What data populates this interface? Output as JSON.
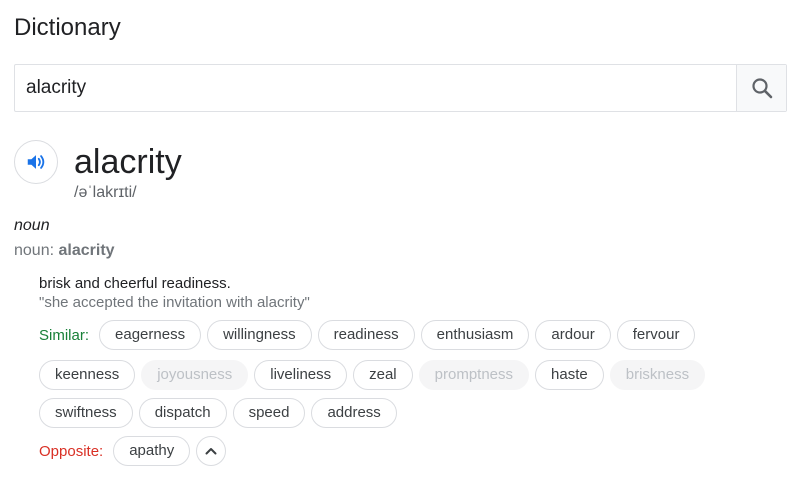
{
  "title": "Dictionary",
  "search": {
    "value": "alacrity",
    "icon": "search-icon"
  },
  "entry": {
    "speaker_icon": "speaker-icon",
    "word": "alacrity",
    "phonetic": "/əˈlakrɪti/",
    "part_of_speech": "noun",
    "noun_label": "noun:",
    "noun_word": "alacrity",
    "definition": "brisk and cheerful readiness.",
    "example": "\"she accepted the invitation with alacrity\""
  },
  "similar": {
    "label": "Similar:",
    "rows": [
      [
        {
          "text": "eagerness",
          "faded": false
        },
        {
          "text": "willingness",
          "faded": false
        },
        {
          "text": "readiness",
          "faded": false
        },
        {
          "text": "enthusiasm",
          "faded": false
        },
        {
          "text": "ardour",
          "faded": false
        },
        {
          "text": "fervour",
          "faded": false
        }
      ],
      [
        {
          "text": "keenness",
          "faded": false
        },
        {
          "text": "joyousness",
          "faded": true
        },
        {
          "text": "liveliness",
          "faded": false
        },
        {
          "text": "zeal",
          "faded": false
        },
        {
          "text": "promptness",
          "faded": true
        },
        {
          "text": "haste",
          "faded": false
        },
        {
          "text": "briskness",
          "faded": true
        }
      ],
      [
        {
          "text": "swiftness",
          "faded": false
        },
        {
          "text": "dispatch",
          "faded": false
        },
        {
          "text": "speed",
          "faded": false
        },
        {
          "text": "address",
          "faded": false
        }
      ]
    ]
  },
  "opposite": {
    "label": "Opposite:",
    "items": [
      {
        "text": "apathy",
        "faded": false
      }
    ],
    "collapse_icon": "chevron-up-icon"
  },
  "colors": {
    "similar_label": "#188038",
    "opposite_label": "#d93025",
    "speaker_blue": "#4285f4"
  }
}
